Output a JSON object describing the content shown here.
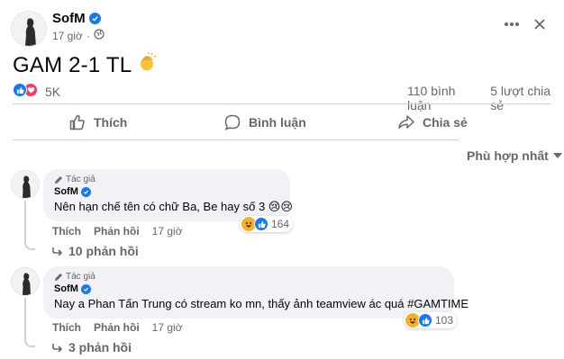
{
  "post": {
    "author": "SofM",
    "time": "17 giờ",
    "text": "GAM 2-1 TL",
    "reaction_count": "5K",
    "comment_count": "110 bình luận",
    "share_count": "5 lượt chia sẻ"
  },
  "actions": {
    "like": "Thích",
    "comment": "Bình luận",
    "share": "Chia sẻ"
  },
  "sort_label": "Phù hợp nhất",
  "comments": [
    {
      "badge": "Tác giả",
      "author": "SofM",
      "text": "Nên hạn chế tên có chữ Ba, Be hay số 3 😢😢",
      "like": "Thích",
      "reply": "Phản hồi",
      "time": "17 giờ",
      "reactions": "164",
      "replies": "10 phản hồi"
    },
    {
      "badge": "Tác giả",
      "author": "SofM",
      "text": "Nay a Phan Tấn Trung có stream ko mn, thấy ảnh teamview ác quá #GAMTIME",
      "like": "Thích",
      "reply": "Phản hồi",
      "time": "17 giờ",
      "reactions": "103",
      "replies": "3 phản hồi"
    }
  ],
  "icons": {
    "verified": "verified-badge-icon",
    "globe": "globe-icon",
    "like": "thumbs-up-icon",
    "comment": "speech-bubble-icon",
    "share": "share-arrow-icon",
    "clap": "clapping-hands-icon",
    "author_badge": "pencil-icon"
  },
  "colors": {
    "brand_blue": "#1877f2",
    "love_red": "#f33e58",
    "haha_yellow": "#f7b125",
    "muted_text": "#65676b",
    "bubble_bg": "#f0f2f5"
  }
}
